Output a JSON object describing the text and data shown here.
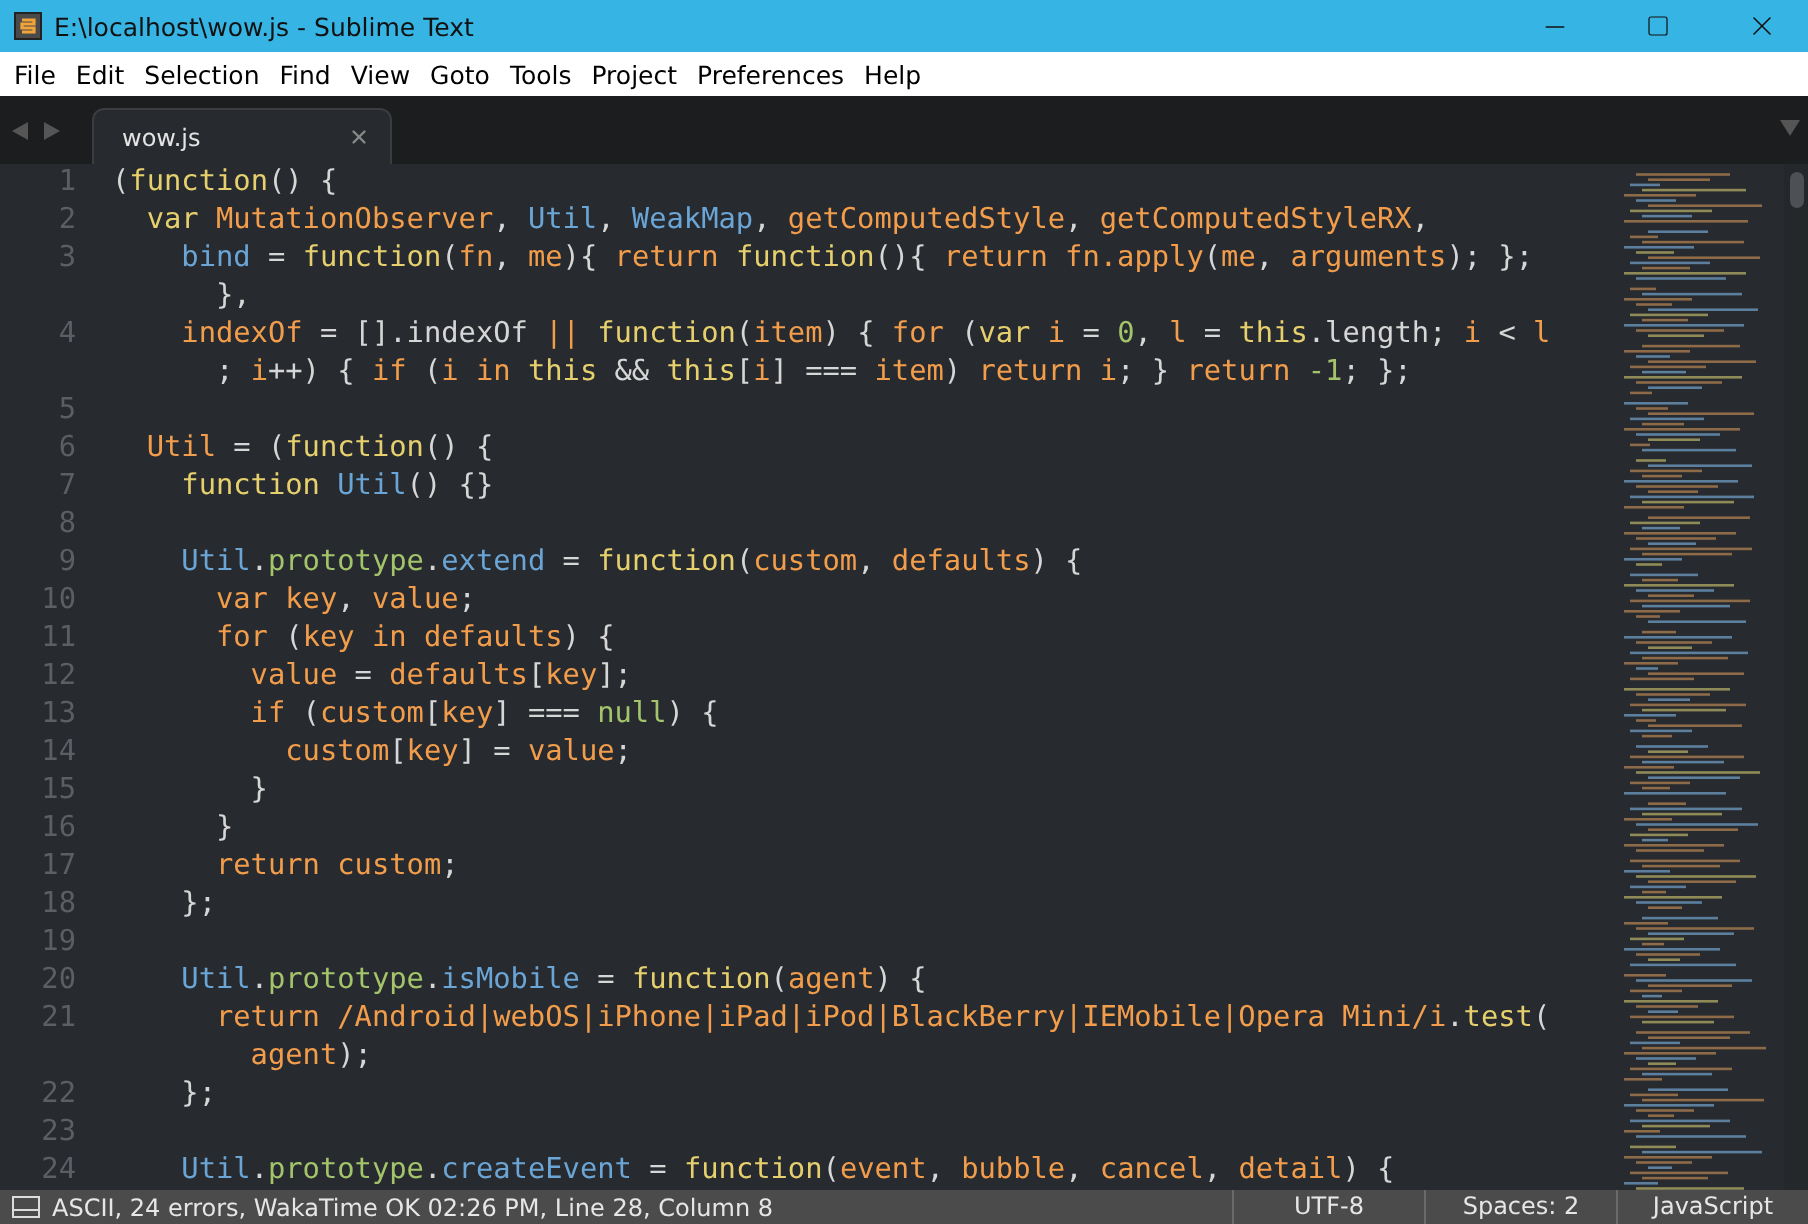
{
  "window": {
    "title": "E:\\localhost\\wow.js - Sublime Text"
  },
  "menu": [
    "File",
    "Edit",
    "Selection",
    "Find",
    "View",
    "Goto",
    "Tools",
    "Project",
    "Preferences",
    "Help"
  ],
  "tabs": [
    {
      "label": "wow.js",
      "selected": true
    }
  ],
  "editor": {
    "lines": [
      {
        "number": "1",
        "rows": [
          {
            "segments": [
              {
                "text": "(",
                "kind": "plain"
              },
              {
                "text": "function",
                "kind": "keyword"
              },
              {
                "text": "() {",
                "kind": "plain"
              }
            ]
          }
        ]
      },
      {
        "number": "2",
        "rows": [
          {
            "segments": [
              {
                "text": "  var ",
                "kind": "keyword"
              },
              {
                "text": "MutationObserver",
                "kind": "variable"
              },
              {
                "text": ", ",
                "kind": "plain"
              },
              {
                "text": "Util",
                "kind": "type"
              },
              {
                "text": ", ",
                "kind": "plain"
              },
              {
                "text": "WeakMap",
                "kind": "type"
              },
              {
                "text": ", ",
                "kind": "plain"
              },
              {
                "text": "getComputedStyle",
                "kind": "variable"
              },
              {
                "text": ", ",
                "kind": "plain"
              },
              {
                "text": "getComputedStyleRX",
                "kind": "variable"
              },
              {
                "text": ",",
                "kind": "plain"
              }
            ]
          }
        ]
      },
      {
        "number": "3",
        "rows": [
          {
            "segments": [
              {
                "text": "    bind",
                "kind": "type"
              },
              {
                "text": " = ",
                "kind": "plain"
              },
              {
                "text": "function",
                "kind": "keyword"
              },
              {
                "text": "(",
                "kind": "plain"
              },
              {
                "text": "fn",
                "kind": "variable"
              },
              {
                "text": ", ",
                "kind": "plain"
              },
              {
                "text": "me",
                "kind": "variable"
              },
              {
                "text": "){ ",
                "kind": "plain"
              },
              {
                "text": "return ",
                "kind": "variable"
              },
              {
                "text": "function",
                "kind": "keyword"
              },
              {
                "text": "(){ ",
                "kind": "plain"
              },
              {
                "text": "return fn.apply",
                "kind": "variable"
              },
              {
                "text": "(",
                "kind": "plain"
              },
              {
                "text": "me",
                "kind": "variable"
              },
              {
                "text": ", ",
                "kind": "plain"
              },
              {
                "text": "arguments",
                "kind": "variable"
              },
              {
                "text": "); };",
                "kind": "plain"
              }
            ]
          },
          {
            "segments": [
              {
                "text": "      },",
                "kind": "plain"
              }
            ]
          }
        ]
      },
      {
        "number": "4",
        "rows": [
          {
            "segments": [
              {
                "text": "    indexOf",
                "kind": "variable"
              },
              {
                "text": " = [].indexOf ",
                "kind": "plain"
              },
              {
                "text": "|| ",
                "kind": "variable"
              },
              {
                "text": "function",
                "kind": "keyword"
              },
              {
                "text": "(",
                "kind": "plain"
              },
              {
                "text": "item",
                "kind": "variable"
              },
              {
                "text": ") { ",
                "kind": "plain"
              },
              {
                "text": "for",
                "kind": "variable"
              },
              {
                "text": " (",
                "kind": "plain"
              },
              {
                "text": "var ",
                "kind": "keyword"
              },
              {
                "text": "i",
                "kind": "variable"
              },
              {
                "text": " = ",
                "kind": "plain"
              },
              {
                "text": "0",
                "kind": "property"
              },
              {
                "text": ", ",
                "kind": "plain"
              },
              {
                "text": "l",
                "kind": "variable"
              },
              {
                "text": " = ",
                "kind": "plain"
              },
              {
                "text": "this",
                "kind": "keyword"
              },
              {
                "text": ".length; ",
                "kind": "plain"
              },
              {
                "text": "i",
                "kind": "variable"
              },
              {
                "text": " < ",
                "kind": "plain"
              },
              {
                "text": "l",
                "kind": "variable"
              }
            ]
          },
          {
            "segments": [
              {
                "text": "      ; ",
                "kind": "plain"
              },
              {
                "text": "i",
                "kind": "variable"
              },
              {
                "text": "++) { ",
                "kind": "plain"
              },
              {
                "text": "if",
                "kind": "variable"
              },
              {
                "text": " (",
                "kind": "plain"
              },
              {
                "text": "i in ",
                "kind": "variable"
              },
              {
                "text": "this",
                "kind": "keyword"
              },
              {
                "text": " && ",
                "kind": "plain"
              },
              {
                "text": "this",
                "kind": "keyword"
              },
              {
                "text": "[",
                "kind": "plain"
              },
              {
                "text": "i",
                "kind": "variable"
              },
              {
                "text": "] === ",
                "kind": "plain"
              },
              {
                "text": "item",
                "kind": "variable"
              },
              {
                "text": ") ",
                "kind": "plain"
              },
              {
                "text": "return i",
                "kind": "variable"
              },
              {
                "text": "; } ",
                "kind": "plain"
              },
              {
                "text": "return ",
                "kind": "variable"
              },
              {
                "text": "-1",
                "kind": "property"
              },
              {
                "text": "; };",
                "kind": "plain"
              }
            ]
          }
        ]
      },
      {
        "number": "5"
      },
      {
        "number": "6",
        "rows": [
          {
            "segments": [
              {
                "text": "  Util",
                "kind": "variable"
              },
              {
                "text": " = (",
                "kind": "plain"
              },
              {
                "text": "function",
                "kind": "keyword"
              },
              {
                "text": "() {",
                "kind": "plain"
              }
            ]
          }
        ]
      },
      {
        "number": "7",
        "rows": [
          {
            "segments": [
              {
                "text": "    function ",
                "kind": "keyword"
              },
              {
                "text": "Util",
                "kind": "type"
              },
              {
                "text": "() {}",
                "kind": "plain"
              }
            ]
          }
        ]
      },
      {
        "number": "8"
      },
      {
        "number": "9",
        "rows": [
          {
            "segments": [
              {
                "text": "    Util",
                "kind": "type"
              },
              {
                "text": ".",
                "kind": "plain"
              },
              {
                "text": "prototype",
                "kind": "property"
              },
              {
                "text": ".",
                "kind": "plain"
              },
              {
                "text": "extend",
                "kind": "type"
              },
              {
                "text": " = ",
                "kind": "plain"
              },
              {
                "text": "function",
                "kind": "keyword"
              },
              {
                "text": "(",
                "kind": "plain"
              },
              {
                "text": "custom",
                "kind": "variable"
              },
              {
                "text": ", ",
                "kind": "plain"
              },
              {
                "text": "defaults",
                "kind": "variable"
              },
              {
                "text": ") {",
                "kind": "plain"
              }
            ]
          }
        ]
      },
      {
        "number": "10",
        "rows": [
          {
            "segments": [
              {
                "text": "      var key",
                "kind": "variable"
              },
              {
                "text": ", ",
                "kind": "plain"
              },
              {
                "text": "value",
                "kind": "variable"
              },
              {
                "text": ";",
                "kind": "plain"
              }
            ]
          }
        ]
      },
      {
        "number": "11",
        "rows": [
          {
            "segments": [
              {
                "text": "      for",
                "kind": "variable"
              },
              {
                "text": " (",
                "kind": "plain"
              },
              {
                "text": "key in defaults",
                "kind": "variable"
              },
              {
                "text": ") {",
                "kind": "plain"
              }
            ]
          }
        ]
      },
      {
        "number": "12",
        "rows": [
          {
            "segments": [
              {
                "text": "        value",
                "kind": "variable"
              },
              {
                "text": " = ",
                "kind": "plain"
              },
              {
                "text": "defaults",
                "kind": "variable"
              },
              {
                "text": "[",
                "kind": "plain"
              },
              {
                "text": "key",
                "kind": "variable"
              },
              {
                "text": "];",
                "kind": "plain"
              }
            ]
          }
        ]
      },
      {
        "number": "13",
        "rows": [
          {
            "segments": [
              {
                "text": "        if",
                "kind": "variable"
              },
              {
                "text": " (",
                "kind": "plain"
              },
              {
                "text": "custom",
                "kind": "variable"
              },
              {
                "text": "[",
                "kind": "plain"
              },
              {
                "text": "key",
                "kind": "variable"
              },
              {
                "text": "] === ",
                "kind": "plain"
              },
              {
                "text": "null",
                "kind": "property"
              },
              {
                "text": ") {",
                "kind": "plain"
              }
            ]
          }
        ]
      },
      {
        "number": "14",
        "rows": [
          {
            "segments": [
              {
                "text": "          custom",
                "kind": "variable"
              },
              {
                "text": "[",
                "kind": "plain"
              },
              {
                "text": "key",
                "kind": "variable"
              },
              {
                "text": "] = ",
                "kind": "plain"
              },
              {
                "text": "value",
                "kind": "variable"
              },
              {
                "text": ";",
                "kind": "plain"
              }
            ]
          }
        ]
      },
      {
        "number": "15",
        "rows": [
          {
            "segments": [
              {
                "text": "        }",
                "kind": "plain"
              }
            ]
          }
        ]
      },
      {
        "number": "16",
        "rows": [
          {
            "segments": [
              {
                "text": "      }",
                "kind": "plain"
              }
            ]
          }
        ]
      },
      {
        "number": "17",
        "rows": [
          {
            "segments": [
              {
                "text": "      return custom",
                "kind": "variable"
              },
              {
                "text": ";",
                "kind": "plain"
              }
            ]
          }
        ]
      },
      {
        "number": "18",
        "rows": [
          {
            "segments": [
              {
                "text": "    };",
                "kind": "plain"
              }
            ]
          }
        ]
      },
      {
        "number": "19"
      },
      {
        "number": "20",
        "rows": [
          {
            "segments": [
              {
                "text": "    Util",
                "kind": "type"
              },
              {
                "text": ".",
                "kind": "plain"
              },
              {
                "text": "prototype",
                "kind": "property"
              },
              {
                "text": ".",
                "kind": "plain"
              },
              {
                "text": "isMobile",
                "kind": "type"
              },
              {
                "text": " = ",
                "kind": "plain"
              },
              {
                "text": "function",
                "kind": "keyword"
              },
              {
                "text": "(",
                "kind": "plain"
              },
              {
                "text": "agent",
                "kind": "variable"
              },
              {
                "text": ") {",
                "kind": "plain"
              }
            ]
          }
        ]
      },
      {
        "number": "21",
        "rows": [
          {
            "segments": [
              {
                "text": "      return /Android|webOS|iPhone|iPad|iPod|BlackBerry|IEMobile|Opera Mini/i",
                "kind": "variable"
              },
              {
                "text": ".",
                "kind": "plain"
              },
              {
                "text": "test",
                "kind": "keyword"
              },
              {
                "text": "(",
                "kind": "plain"
              }
            ]
          },
          {
            "segments": [
              {
                "text": "        agent",
                "kind": "variable"
              },
              {
                "text": ");",
                "kind": "plain"
              }
            ]
          }
        ]
      },
      {
        "number": "22",
        "rows": [
          {
            "segments": [
              {
                "text": "    };",
                "kind": "plain"
              }
            ]
          }
        ]
      },
      {
        "number": "23"
      },
      {
        "number": "24",
        "rows": [
          {
            "segments": [
              {
                "text": "    Util",
                "kind": "type"
              },
              {
                "text": ".",
                "kind": "plain"
              },
              {
                "text": "prototype",
                "kind": "property"
              },
              {
                "text": ".",
                "kind": "plain"
              },
              {
                "text": "createEvent",
                "kind": "type"
              },
              {
                "text": " = ",
                "kind": "plain"
              },
              {
                "text": "function",
                "kind": "keyword"
              },
              {
                "text": "(",
                "kind": "plain"
              },
              {
                "text": "event",
                "kind": "variable"
              },
              {
                "text": ", ",
                "kind": "plain"
              },
              {
                "text": "bubble",
                "kind": "variable"
              },
              {
                "text": ", ",
                "kind": "plain"
              },
              {
                "text": "cancel",
                "kind": "variable"
              },
              {
                "text": ", ",
                "kind": "plain"
              },
              {
                "text": "detail",
                "kind": "variable"
              },
              {
                "text": ") {",
                "kind": "plain"
              }
            ]
          }
        ]
      }
    ]
  },
  "status_bar": {
    "message": "ASCII, 24 errors, WakaTime OK 02:26 PM, Line 28, Column 8",
    "items": [
      "UTF-8",
      "Spaces: 2",
      "JavaScript"
    ]
  }
}
